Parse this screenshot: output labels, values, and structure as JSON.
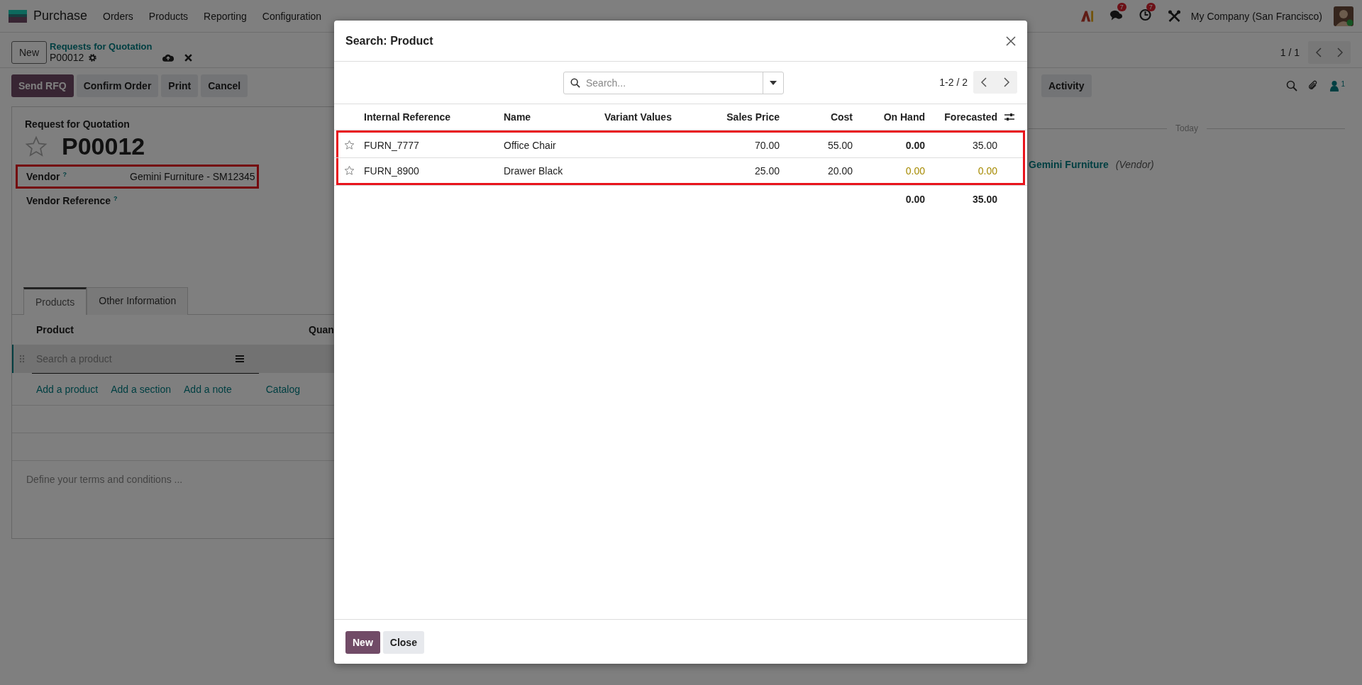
{
  "navbar": {
    "app": "Purchase",
    "menus": [
      "Orders",
      "Products",
      "Reporting",
      "Configuration"
    ],
    "messages_badge": "7",
    "activities_badge": "7",
    "company": "My Company (San Francisco)"
  },
  "breadcrumb": {
    "new_button": "New",
    "parent": "Requests for Quotation",
    "current": "P00012"
  },
  "pager": "1 / 1",
  "actions": [
    {
      "label": "Send RFQ",
      "primary": true
    },
    {
      "label": "Confirm Order",
      "primary": false
    },
    {
      "label": "Print",
      "primary": false
    },
    {
      "label": "Cancel",
      "primary": false
    }
  ],
  "chatter": {
    "activity_button": "Activity",
    "followers": "1",
    "divider": "Today",
    "author": "Gemini Furniture",
    "role": "(Vendor)"
  },
  "form": {
    "caption": "Request for Quotation",
    "name": "P00012",
    "favorite": false,
    "fields": [
      {
        "label": "Vendor",
        "help": "?",
        "value": "Gemini Furniture - SM12345",
        "highlighted": true
      },
      {
        "label": "Vendor Reference",
        "help": "?",
        "highlighted": false
      }
    ],
    "tabs": [
      {
        "label": "Products",
        "selected": true
      },
      {
        "label": "Other Information",
        "selected": false
      }
    ],
    "lines": {
      "columns": [
        "Product",
        "Quan"
      ],
      "placeholder": "Search a product",
      "add_links": [
        "Add a product",
        "Add a section",
        "Add a note",
        "Catalog"
      ]
    },
    "terms_placeholder": "Define your terms and conditions ..."
  },
  "dialog": {
    "title": "Search: Product",
    "search_placeholder": "Search...",
    "pager": "1-2 / 2",
    "columns": [
      "Internal Reference",
      "Name",
      "Variant Values",
      "Sales Price",
      "Cost",
      "On Hand",
      "Forecasted"
    ],
    "highlighted": true,
    "rows": [
      {
        "favorite": false,
        "reference": "FURN_7777",
        "name": "Office Chair",
        "sales_price": "70.00",
        "cost": "55.00",
        "on_hand": "0.00",
        "forecasted": "35.00",
        "warning": false
      },
      {
        "favorite": false,
        "reference": "FURN_8900",
        "name": "Drawer Black",
        "sales_price": "25.00",
        "cost": "20.00",
        "on_hand": "0.00",
        "forecasted": "0.00",
        "warning": true
      }
    ],
    "totals": {
      "on_hand": "0.00",
      "forecasted": "35.00"
    },
    "buttons": [
      {
        "label": "New",
        "primary": true
      },
      {
        "label": "Close",
        "primary": false
      }
    ]
  }
}
